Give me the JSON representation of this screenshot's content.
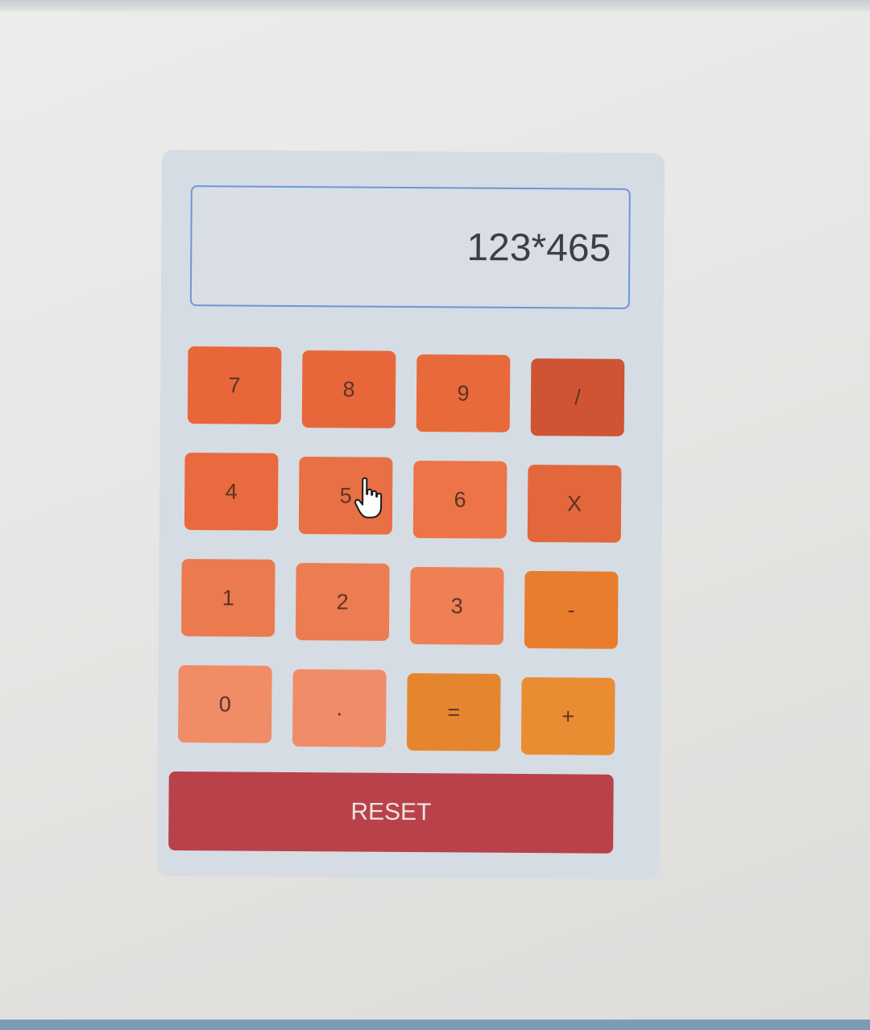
{
  "display": {
    "value": "123*465"
  },
  "keys": [
    {
      "label": "7",
      "color": "#e8663a"
    },
    {
      "label": "8",
      "color": "#e8673a"
    },
    {
      "label": "9",
      "color": "#e86a3a"
    },
    {
      "label": "/",
      "color": "#cf5434"
    },
    {
      "label": "4",
      "color": "#e86a3e"
    },
    {
      "label": "5",
      "color": "#e96f44"
    },
    {
      "label": "6",
      "color": "#ec7446"
    },
    {
      "label": "X",
      "color": "#e2673a"
    },
    {
      "label": "1",
      "color": "#eb7a4e"
    },
    {
      "label": "2",
      "color": "#ec7c51"
    },
    {
      "label": "3",
      "color": "#ee8054"
    },
    {
      "label": "-",
      "color": "#e87d2e"
    },
    {
      "label": "0",
      "color": "#f08c66"
    },
    {
      "label": ".",
      "color": "#f08c68"
    },
    {
      "label": "=",
      "color": "#e5862f"
    },
    {
      "label": "+",
      "color": "#ea8c32"
    }
  ],
  "reset": {
    "label": "RESET",
    "color": "#b9414a"
  }
}
